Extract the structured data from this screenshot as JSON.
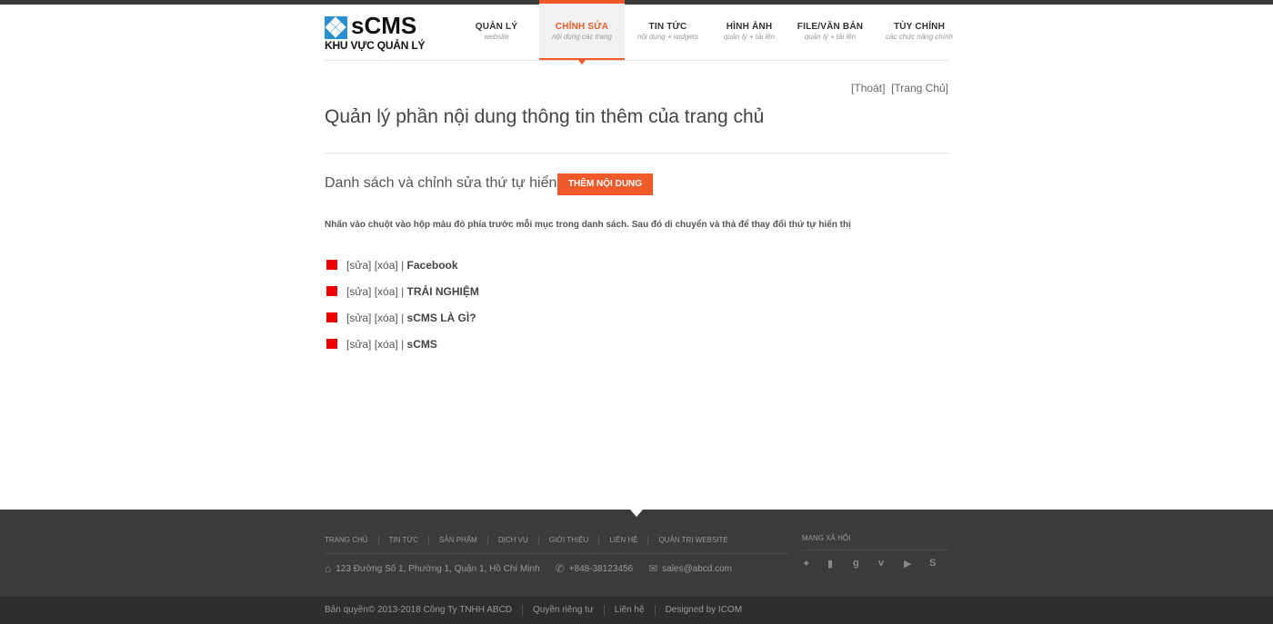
{
  "logo": {
    "text": "sCMS",
    "subtitle": "KHU VỰC QUẢN LÝ"
  },
  "nav": [
    {
      "title": "QUẢN LÝ",
      "sub": "website",
      "active": false
    },
    {
      "title": "CHỈNH SỬA",
      "sub": "nội dung các trang",
      "active": true
    },
    {
      "title": "TIN TỨC",
      "sub": "nội dung + widgets",
      "active": false
    },
    {
      "title": "HÌNH ẢNH",
      "sub": "quản lý + tải lên",
      "active": false
    },
    {
      "title": "FILE/VĂN BẢN",
      "sub": "quản lý + tải lên",
      "active": false
    },
    {
      "title": "TÙY CHỈNH",
      "sub": "các chức năng chính",
      "active": false
    }
  ],
  "accent_color": "#f05a28",
  "top_links": {
    "logout": "[Thoát]",
    "home": "[Trang Chủ]"
  },
  "page_title": "Quản lý phần nội dung thông tin thêm của trang chủ",
  "section_title": "Danh sách và chỉnh sửa thứ tự hiển thị",
  "add_button": "THÊM NỘI DUNG",
  "instruction": "Nhấn vào chuột vào hộp màu đỏ phía trước mỗi mục trong danh sách. Sau đó di chuyển và thả để thay đổi thứ tự hiển thị",
  "item_actions": {
    "edit": "[sửa]",
    "delete": "[xóa]",
    "sep": "|"
  },
  "items": [
    {
      "name": "Facebook"
    },
    {
      "name": "TRẢI NGHIỆM"
    },
    {
      "name": "sCMS LÀ GÌ?"
    },
    {
      "name": "sCMS"
    }
  ],
  "footer": {
    "nav": [
      "TRANG CHỦ",
      "TIN TỨC",
      "SẢN PHẨM",
      "DỊCH VỤ",
      "GIỚI THIỆU",
      "LIÊN HỆ",
      "QUẢN TRỊ WEBSITE"
    ],
    "address": "123 Đường Số 1, Phường 1, Quận 1, Hồ Chí Minh",
    "phone": "+848-38123456",
    "email": "sales@abcd.com",
    "social_title": "MẠNG XÃ HỘI",
    "social_icons": [
      "twitter-icon",
      "facebook-icon",
      "google-plus-icon",
      "vimeo-icon",
      "youtube-icon",
      "skype-icon"
    ],
    "copyright": "Bản quyền© 2013-2018 Công Ty TNHH ABCD",
    "privacy": "Quyền riêng tư",
    "contact": "Liên hệ",
    "designed": "Designed by ICOM"
  }
}
